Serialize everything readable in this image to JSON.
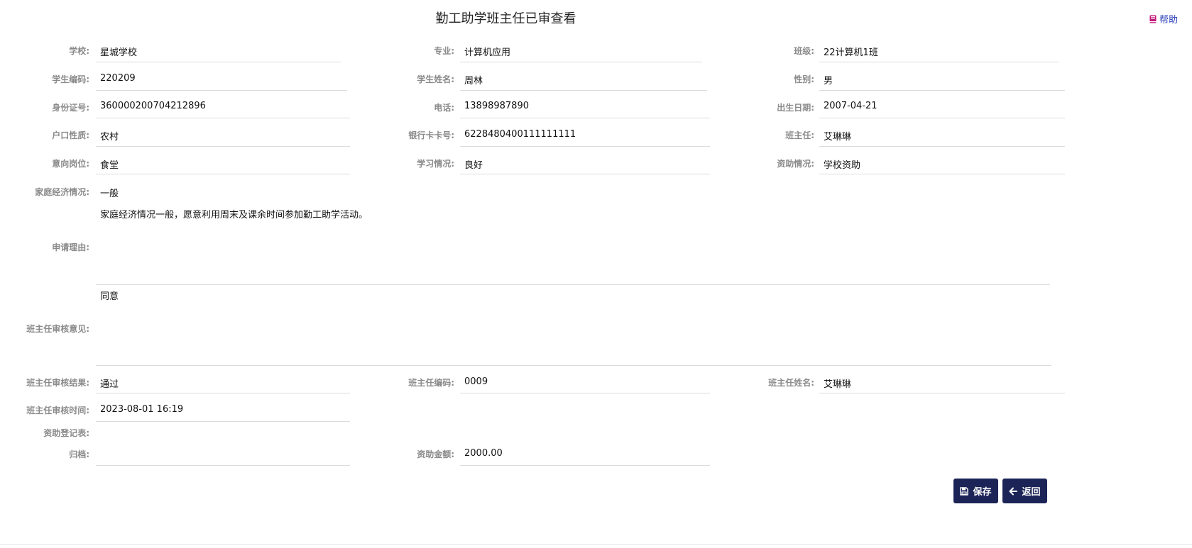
{
  "page": {
    "title": "勤工助学班主任已审查看",
    "help_label": "帮助"
  },
  "fields": {
    "school": {
      "label": "学校:",
      "value": "星城学校"
    },
    "major": {
      "label": "专业:",
      "value": "计算机应用"
    },
    "class": {
      "label": "班级:",
      "value": "22计算机1班"
    },
    "student_code": {
      "label": "学生编码:",
      "value": "220209"
    },
    "student_name": {
      "label": "学生姓名:",
      "value": "周林"
    },
    "gender": {
      "label": "性别:",
      "value": "男"
    },
    "id_number": {
      "label": "身份证号:",
      "value": "360000200704212896"
    },
    "phone": {
      "label": "电话:",
      "value": "13898987890"
    },
    "birth_date": {
      "label": "出生日期:",
      "value": "2007-04-21"
    },
    "household_type": {
      "label": "户口性质:",
      "value": "农村"
    },
    "bank_card": {
      "label": "银行卡卡号:",
      "value": "6228480400111111111"
    },
    "head_teacher": {
      "label": "班主任:",
      "value": "艾琳琳"
    },
    "desired_post": {
      "label": "意向岗位:",
      "value": "食堂"
    },
    "study_status": {
      "label": "学习情况:",
      "value": "良好"
    },
    "aid_status": {
      "label": "资助情况:",
      "value": "学校资助"
    },
    "family_economy": {
      "label": "家庭经济情况:",
      "value": "一般"
    },
    "reason": {
      "label": "申请理由:",
      "value": "家庭经济情况一般，愿意利用周末及课余时间参加勤工助学活动。"
    },
    "review_opinion": {
      "label": "班主任审核意见:",
      "value": "同意"
    },
    "review_result": {
      "label": "班主任审核结果:",
      "value": "通过"
    },
    "teacher_code": {
      "label": "班主任编码:",
      "value": "0009"
    },
    "teacher_name": {
      "label": "班主任姓名:",
      "value": "艾琳琳"
    },
    "review_time": {
      "label": "班主任审核时间:",
      "value": "2023-08-01 16:19"
    },
    "aid_form": {
      "label": "资助登记表:",
      "value": ""
    },
    "archive": {
      "label": "归档:",
      "value": ""
    },
    "aid_amount": {
      "label": "资助金额:",
      "value": "2000.00"
    }
  },
  "actions": {
    "save_label": "保存",
    "back_label": "返回"
  },
  "icons": {
    "help": "book-icon",
    "save": "floppy-disk-icon",
    "back": "arrow-left-icon"
  },
  "colors": {
    "button_bg": "#1c2457",
    "label": "#8a8a8a",
    "help_link": "#2a3fb8",
    "help_icon": "#c2187a"
  }
}
